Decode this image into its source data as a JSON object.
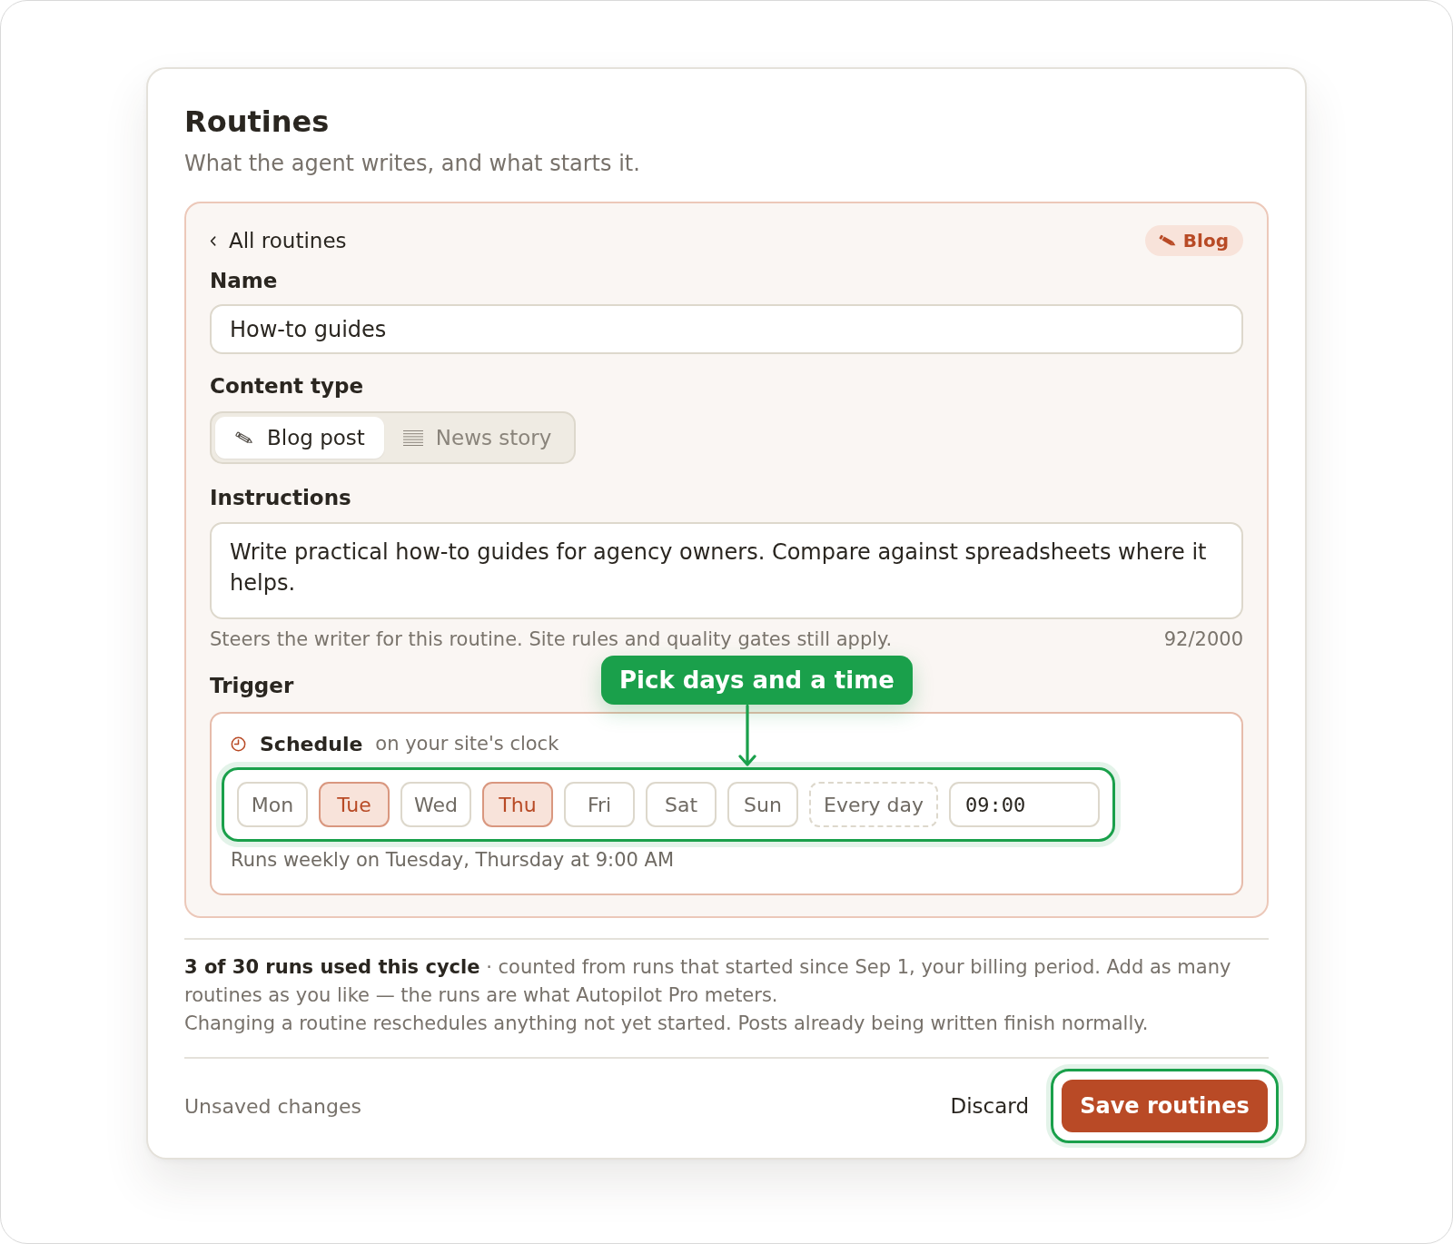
{
  "header": {
    "title": "Routines",
    "subtitle": "What the agent writes, and what starts it."
  },
  "editor": {
    "back_link": "All routines",
    "badge": "Blog",
    "name": {
      "label": "Name",
      "value": "How-to guides"
    },
    "content_type": {
      "label": "Content type",
      "options": [
        {
          "label": "Blog post",
          "selected": true
        },
        {
          "label": "News story",
          "selected": false
        }
      ]
    },
    "instructions": {
      "label": "Instructions",
      "value": "Write practical how-to guides for agency owners. Compare against spreadsheets where it helps.",
      "hint": "Steers the writer for this routine. Site rules and quality gates still apply.",
      "counter": "92/2000"
    },
    "trigger": {
      "label": "Trigger",
      "schedule": {
        "title": "Schedule",
        "note": "on your site's clock",
        "highlighted": true,
        "days": [
          {
            "label": "Mon",
            "selected": false
          },
          {
            "label": "Tue",
            "selected": true
          },
          {
            "label": "Wed",
            "selected": false
          },
          {
            "label": "Thu",
            "selected": true
          },
          {
            "label": "Fri",
            "selected": false
          },
          {
            "label": "Sat",
            "selected": false
          },
          {
            "label": "Sun",
            "selected": false
          }
        ],
        "every_day": {
          "label": "Every day",
          "selected": false
        },
        "time": "09:00",
        "summary": "Runs weekly on Tuesday, Thursday at 9:00 AM"
      }
    }
  },
  "callout": {
    "text": "Pick days and a time"
  },
  "usage": {
    "text": "**3 of 30 runs used this cycle** · counted from runs that started since Sep 1, your billing period. Add as many routines as you like — the runs are what Autopilot Pro meters.",
    "note": "Changing a routine reschedules anything not yet started. Posts already being written finish normally."
  },
  "footer": {
    "status": "Unsaved changes",
    "discard": "Discard",
    "save": {
      "label": "Save routines",
      "highlighted": true
    }
  }
}
